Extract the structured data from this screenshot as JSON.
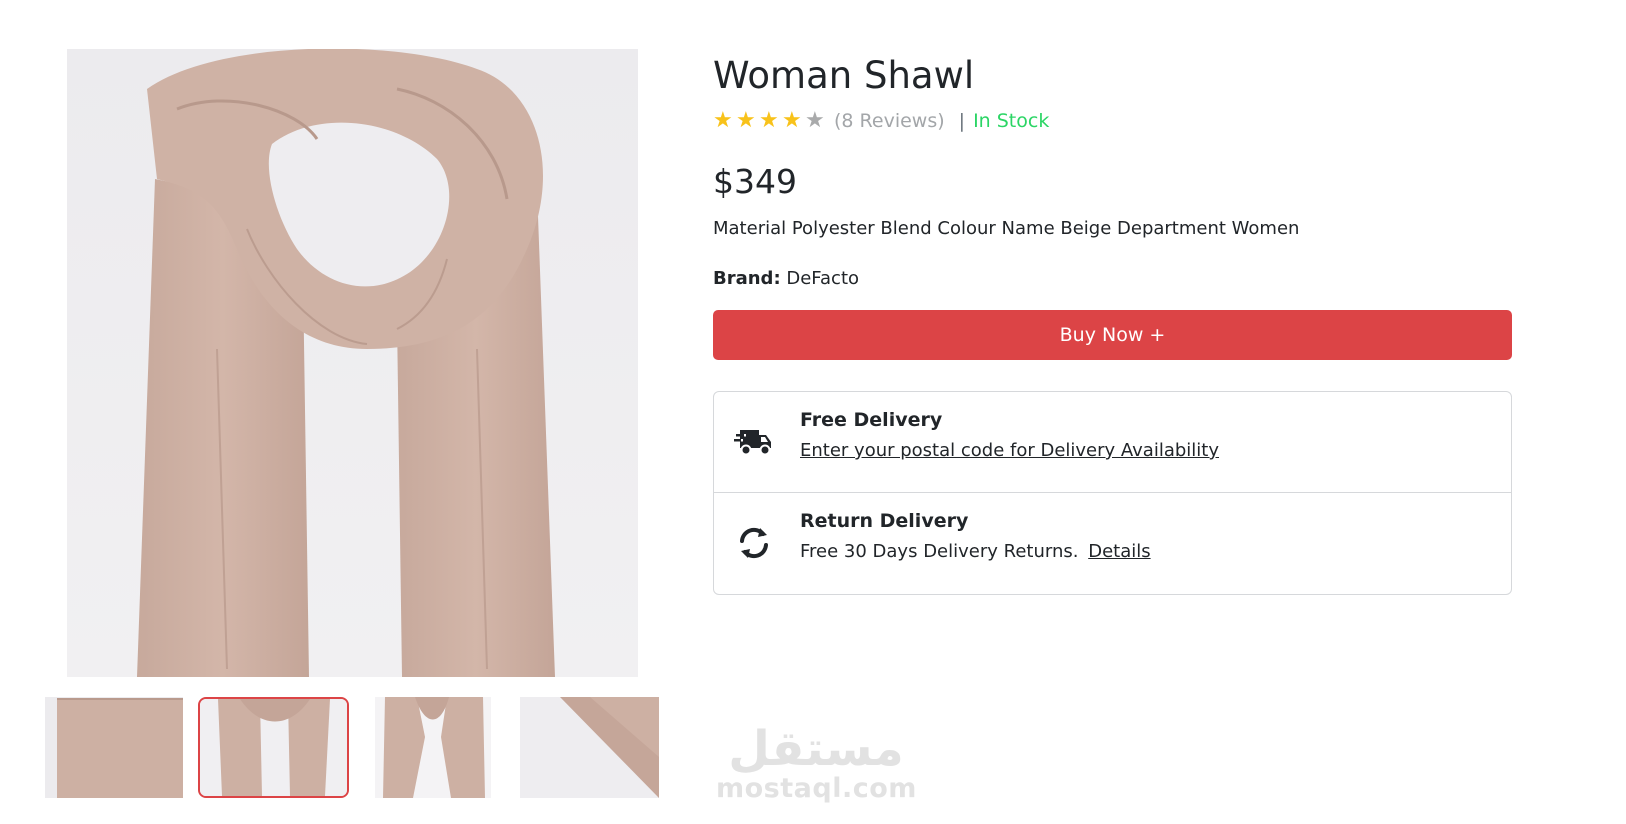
{
  "product": {
    "title": "Woman Shawl",
    "rating": 4,
    "rating_max": 5,
    "reviews_label": "(8 Reviews)",
    "separator": "|",
    "stock_status": "In Stock",
    "price": "$349",
    "description": "Material Polyester Blend Colour Name Beige Department Women",
    "brand_label": "Brand:",
    "brand_value": "DeFacto",
    "buy_button_label": "Buy Now +"
  },
  "delivery": {
    "free": {
      "icon": "truck-fast-icon",
      "title": "Free Delivery",
      "link_text": "Enter your postal code for Delivery Availability"
    },
    "returns": {
      "icon": "rotate-icon",
      "title": "Return Delivery",
      "text": "Free 30 Days Delivery Returns.",
      "link_text": "Details"
    }
  },
  "gallery": {
    "thumbnail_count": 4,
    "active_thumbnail": 2
  },
  "watermark": {
    "arabic": "مستقل",
    "latin": "mostaql.com"
  },
  "colors": {
    "accent": "#dc4446",
    "in_stock": "#2bd565",
    "star_filled": "#f8c21a",
    "star_empty": "#a9aaab",
    "shawl": "#cdb0a3"
  }
}
